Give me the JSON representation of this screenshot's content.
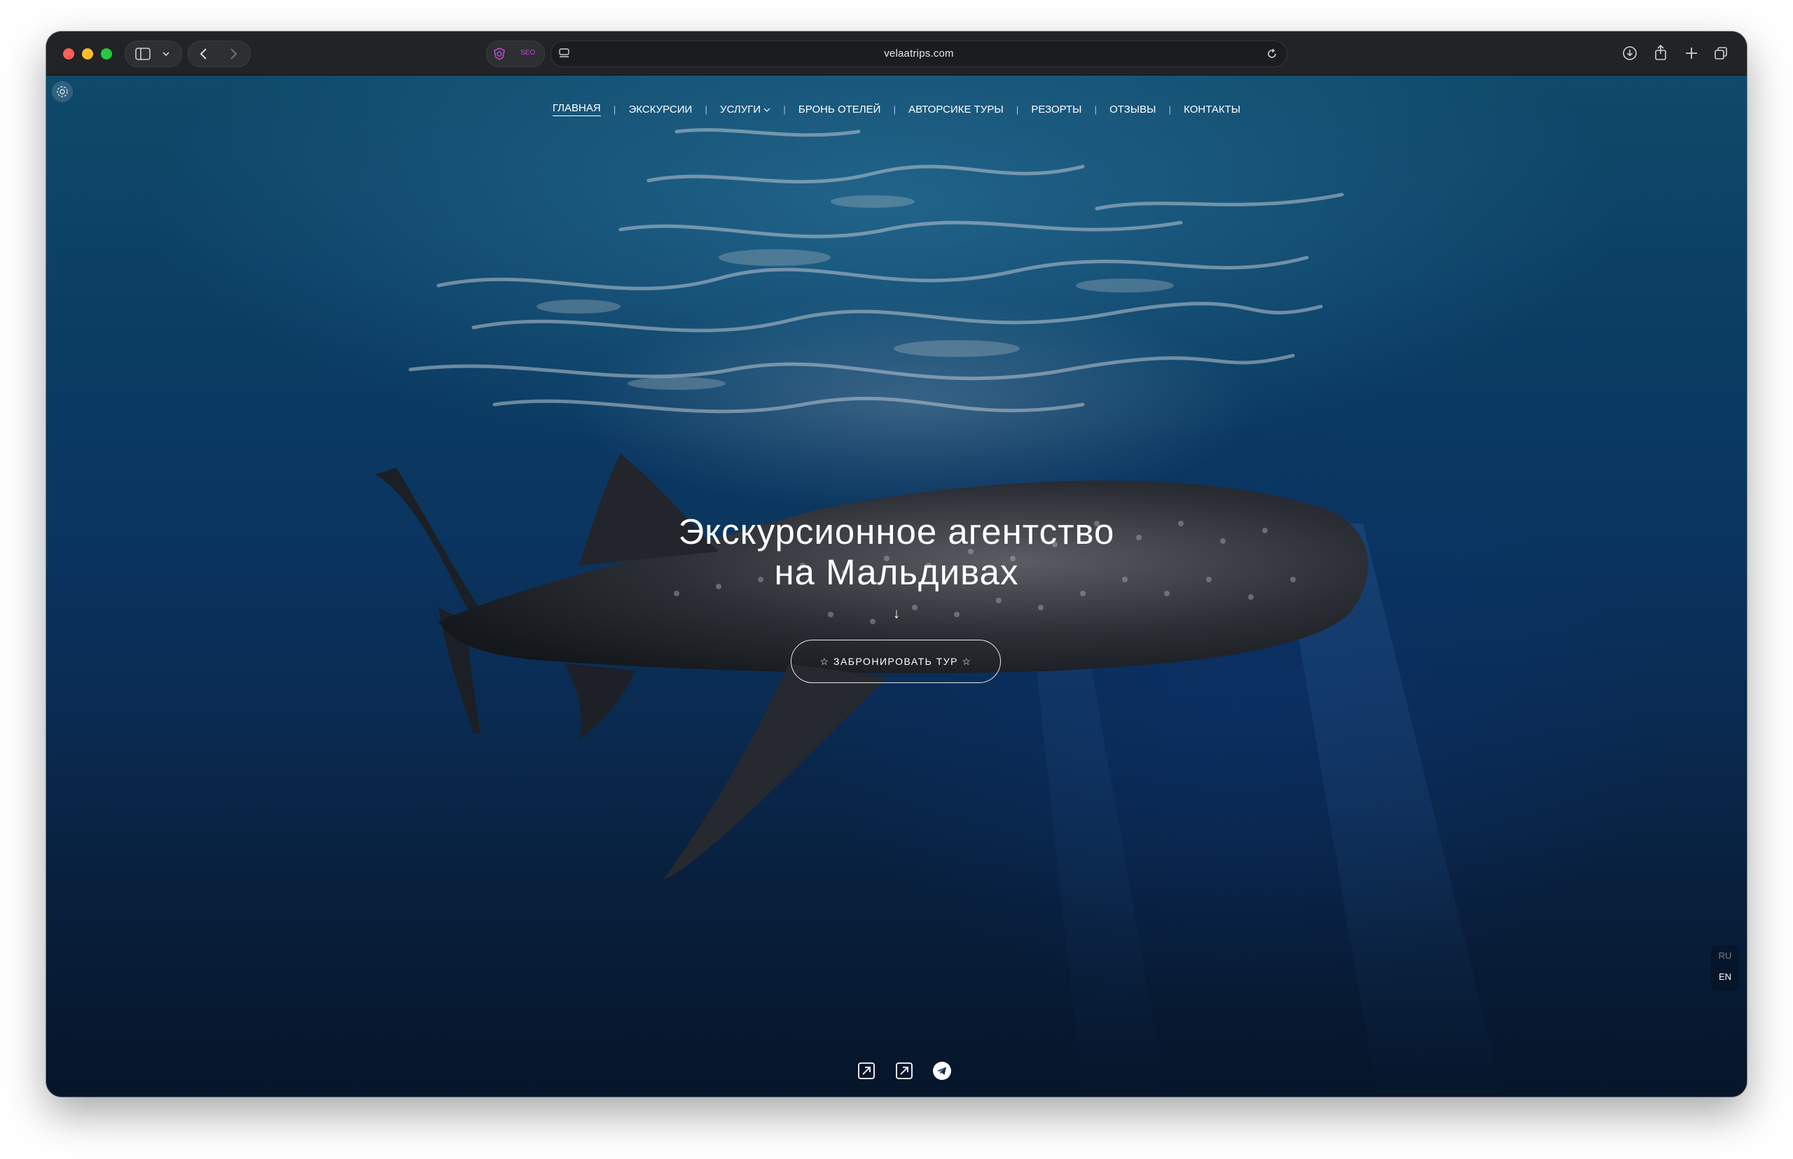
{
  "browser": {
    "url": "velaatrips.com",
    "seo_label": "SEO",
    "icons": [
      "sidebar-icon",
      "chevron-down-icon",
      "back-icon",
      "forward-icon",
      "seo-extension-icon",
      "page-settings-icon",
      "reload-icon",
      "download-icon",
      "share-icon",
      "new-tab-icon",
      "tabs-overview-icon"
    ]
  },
  "site": {
    "nav": [
      {
        "label": "ГЛАВНАЯ",
        "active": true
      },
      {
        "label": "ЭКСКУРСИИ"
      },
      {
        "label": "УСЛУГИ",
        "dropdown": true
      },
      {
        "label": "БРОНЬ ОТЕЛЕЙ"
      },
      {
        "label": "АВТОРСИКЕ ТУРЫ"
      },
      {
        "label": "РЕЗОРТЫ"
      },
      {
        "label": "ОТЗЫВЫ"
      },
      {
        "label": "КОНТАКТЫ"
      }
    ],
    "hero": {
      "title_line1": "Экскурсионное агентство",
      "title_line2": "на Мальдивах",
      "scroll_arrow": "↓",
      "cta_label": "☆ ЗАБРОНИРОВАТЬ ТУР ☆"
    },
    "languages": [
      "RU",
      "EN"
    ],
    "active_language": "EN",
    "social_icons": [
      "external-link-icon",
      "external-link-icon",
      "telegram-icon"
    ],
    "colors": {
      "water_top": "#0f4a6a",
      "water_bottom": "#06152a",
      "text": "#ffffff"
    }
  }
}
